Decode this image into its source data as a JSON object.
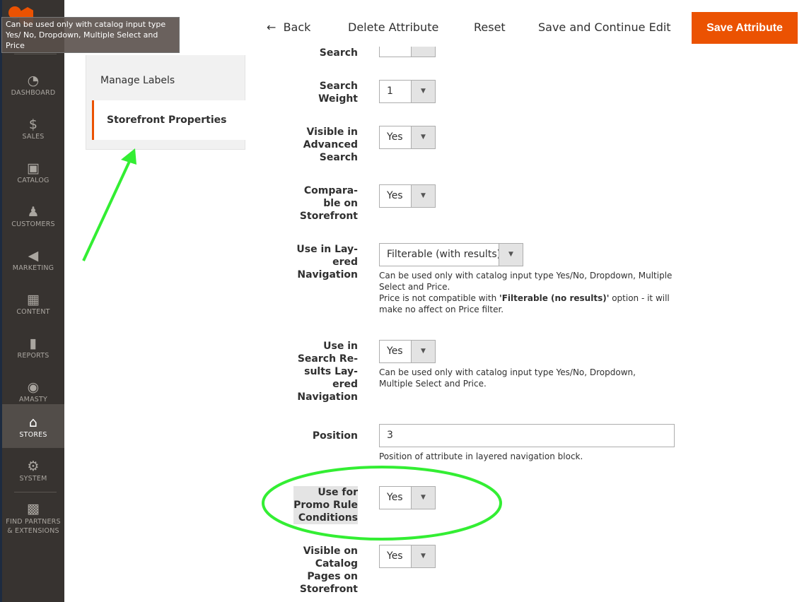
{
  "tooltip": "Can be used only with catalog input type Yes/ No, Dropdown, Multiple Select and Price",
  "sidebar": {
    "items": [
      {
        "label": "DASHBOARD",
        "icon": "dashboard-icon",
        "glyph": "◔"
      },
      {
        "label": "SALES",
        "icon": "dollar-icon",
        "glyph": "$"
      },
      {
        "label": "CATALOG",
        "icon": "box-icon",
        "glyph": "▣"
      },
      {
        "label": "CUSTOMERS",
        "icon": "person-icon",
        "glyph": "♟"
      },
      {
        "label": "MARKETING",
        "icon": "megaphone-icon",
        "glyph": "◀"
      },
      {
        "label": "CONTENT",
        "icon": "layout-icon",
        "glyph": "▦"
      },
      {
        "label": "REPORTS",
        "icon": "bar-chart-icon",
        "glyph": "▮"
      },
      {
        "label": "AMASTY",
        "icon": "amasty-icon",
        "glyph": "◉"
      },
      {
        "label": "STORES",
        "icon": "storefront-icon",
        "glyph": "⌂",
        "active": true
      },
      {
        "label": "SYSTEM",
        "icon": "gear-icon",
        "glyph": "⚙"
      },
      {
        "label": "FIND PARTNERS & EXTENSIONS",
        "icon": "lego-brick-icon",
        "glyph": "▩"
      }
    ]
  },
  "header": {
    "back": "Back",
    "delete": "Delete Attribute",
    "reset": "Reset",
    "save_continue": "Save and Continue Edit",
    "save": "Save Attribute",
    "accent": "#eb5202"
  },
  "tabs": [
    {
      "label": "Manage Labels"
    },
    {
      "label": "Storefront Properties"
    }
  ],
  "form": {
    "search_cut": "Search",
    "search_weight": {
      "label": "Search\nWeight",
      "value": "1"
    },
    "visible_adv": {
      "label": "Visible in\nAdvanced\nSearch",
      "value": "Yes"
    },
    "comparable": {
      "label": "Compara-\nble on\nStorefront",
      "value": "Yes"
    },
    "layered": {
      "label": "Use in Lay-\nered\nNavigation",
      "value": "Filterable (with results)",
      "note1": "Can be used only with catalog input type Yes/No, Dropdown, Multiple Select and Price.",
      "note2a": "Price is not compatible with ",
      "note2b": "'Filterable (no results)'",
      "note2c": " option - it will make no affect on Price filter."
    },
    "search_layered": {
      "label": "Use in\nSearch Re-\nsults Lay-\nered\nNavigation",
      "value": "Yes",
      "note": "Can be used only with catalog input type Yes/No, Dropdown, Multiple Select and Price."
    },
    "position": {
      "label": "Position",
      "value": "3",
      "note": "Position of attribute in layered navigation block."
    },
    "promo": {
      "label": "Use for\nPromo Rule\nConditions",
      "value": "Yes"
    },
    "visible_catalog": {
      "label": "Visible on\nCatalog\nPages on\nStorefront",
      "value": "Yes"
    }
  },
  "annotation_color": "#33ee33"
}
